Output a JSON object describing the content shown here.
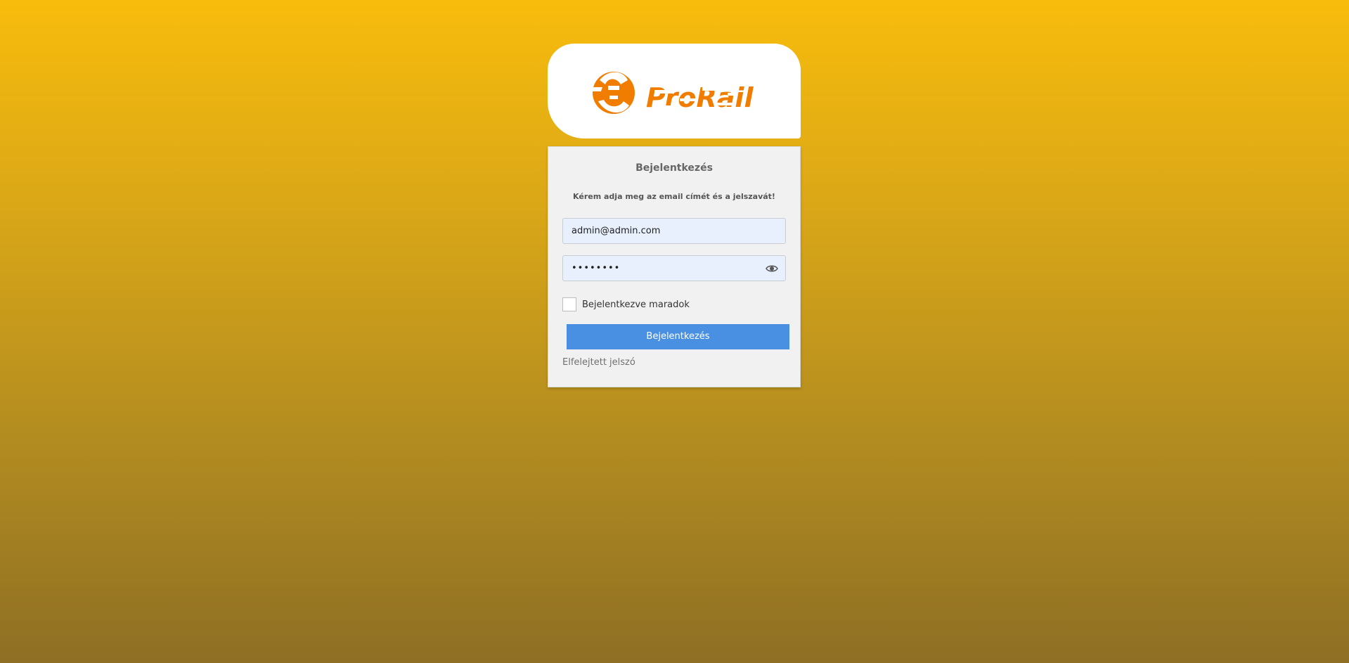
{
  "brand": {
    "logo_text": "ProRail",
    "accent_color": "#f07d00"
  },
  "login": {
    "title": "Bejelentkezés",
    "subtitle": "Kérem adja meg az email címét és a jelszavát!",
    "email_value": "admin@admin.com",
    "password_value": "••••••••",
    "remember_label": "Bejelentkezve maradok",
    "remember_checked": false,
    "submit_label": "Bejelentkezés",
    "forgot_label": "Elfelejtett jelszó"
  },
  "icons": {
    "password_toggle": "eye-icon"
  },
  "colors": {
    "background_top": "#f8bc0c",
    "background_bottom": "#8e6f24",
    "button": "#4a90e2",
    "field_fill": "#e8f0fe"
  }
}
